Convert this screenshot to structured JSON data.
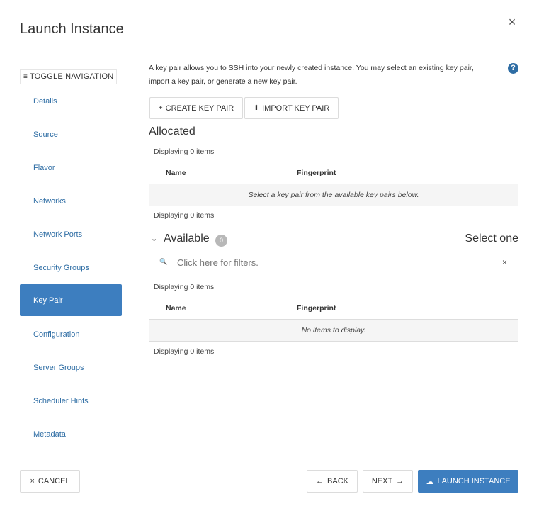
{
  "modal": {
    "title": "Launch Instance",
    "close_glyph": "×"
  },
  "toggle_nav": {
    "glyph": "≡",
    "label": "TOGGLE NAVIGATION"
  },
  "nav": {
    "items": [
      "Details",
      "Source",
      "Flavor",
      "Networks",
      "Network Ports",
      "Security Groups",
      "Key Pair",
      "Configuration",
      "Server Groups",
      "Scheduler Hints",
      "Metadata"
    ],
    "active": "Key Pair"
  },
  "keypair": {
    "intro_line1": "A key pair allows you to SSH into your newly created instance. You may select an existing key pair,",
    "intro_line2": "import a key pair, or generate a new key pair.",
    "help_glyph": "?",
    "create_glyph": "+",
    "create_label": "CREATE KEY PAIR",
    "import_glyph": "⬆",
    "import_label": "IMPORT KEY PAIR"
  },
  "allocated": {
    "title": "Allocated",
    "count_top": "Displaying 0 items",
    "columns": [
      "Name",
      "Fingerprint"
    ],
    "empty_msg": "Select a key pair from the available key pairs below.",
    "count_bottom": "Displaying 0 items"
  },
  "available": {
    "chevron": "⌄",
    "title": "Available",
    "badge": "0",
    "select_one": "Select one",
    "search_glyph": "🔍",
    "filter_placeholder": "Click here for filters.",
    "clear_glyph": "×",
    "count_top": "Displaying 0 items",
    "columns": [
      "Name",
      "Fingerprint"
    ],
    "empty_msg": "No items to display.",
    "count_bottom": "Displaying 0 items"
  },
  "footer": {
    "cancel_glyph": "×",
    "cancel": "CANCEL",
    "back_glyph": "←",
    "back": "BACK",
    "next": "NEXT",
    "next_glyph": "→",
    "launch_glyph": "☁",
    "launch": "LAUNCH INSTANCE"
  },
  "colors": {
    "primary": "#3d7ebf",
    "link": "#2e6da4",
    "badge": "#b8b8b8"
  }
}
